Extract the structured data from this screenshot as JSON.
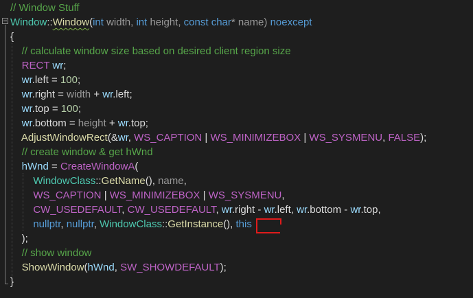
{
  "colors": {
    "background": "#1e1e1e",
    "comment": "#57a64a",
    "keyword": "#569cd6",
    "type": "#4ec9b0",
    "function": "#dcdcaa",
    "macro": "#bd63c5",
    "identifier": "#9cdcfe",
    "param": "#9a9a9a",
    "number": "#b5cea8",
    "default": "#dcdcdc",
    "annotation": "#e01b1b"
  },
  "code_lines": [
    [
      {
        "t": "// Window Stuff",
        "c": "comment"
      }
    ],
    [
      {
        "t": "Window",
        "c": "type"
      },
      {
        "t": "::",
        "c": "default"
      },
      {
        "t": "Window",
        "c": "function",
        "sq": true
      },
      {
        "t": "(",
        "c": "default"
      },
      {
        "t": "int",
        "c": "keyword"
      },
      {
        "t": " width, ",
        "c": "param"
      },
      {
        "t": "int",
        "c": "keyword"
      },
      {
        "t": " height, ",
        "c": "param"
      },
      {
        "t": "const",
        "c": "keyword"
      },
      {
        "t": " ",
        "c": "default"
      },
      {
        "t": "char",
        "c": "keyword"
      },
      {
        "t": "* name) ",
        "c": "param"
      },
      {
        "t": "noexcept",
        "c": "keyword"
      }
    ],
    [
      {
        "t": "{",
        "c": "default"
      }
    ],
    [
      {
        "t": "    // calculate window size based on desired client region size",
        "c": "comment"
      }
    ],
    [
      {
        "t": "    RECT",
        "c": "macro"
      },
      {
        "t": " ",
        "c": "default"
      },
      {
        "t": "wr",
        "c": "identifier"
      },
      {
        "t": ";",
        "c": "default"
      }
    ],
    [
      {
        "t": "    wr",
        "c": "identifier"
      },
      {
        "t": ".left = ",
        "c": "default"
      },
      {
        "t": "100",
        "c": "number"
      },
      {
        "t": ";",
        "c": "default"
      }
    ],
    [
      {
        "t": "    wr",
        "c": "identifier"
      },
      {
        "t": ".right = ",
        "c": "default"
      },
      {
        "t": "width",
        "c": "param"
      },
      {
        "t": " + ",
        "c": "default"
      },
      {
        "t": "wr",
        "c": "identifier"
      },
      {
        "t": ".left;",
        "c": "default"
      }
    ],
    [
      {
        "t": "    wr",
        "c": "identifier"
      },
      {
        "t": ".top = ",
        "c": "default"
      },
      {
        "t": "100",
        "c": "number"
      },
      {
        "t": ";",
        "c": "default"
      }
    ],
    [
      {
        "t": "    wr",
        "c": "identifier"
      },
      {
        "t": ".bottom = ",
        "c": "default"
      },
      {
        "t": "height",
        "c": "param"
      },
      {
        "t": " + ",
        "c": "default"
      },
      {
        "t": "wr",
        "c": "identifier"
      },
      {
        "t": ".top;",
        "c": "default"
      }
    ],
    [
      {
        "t": "    AdjustWindowRect",
        "c": "function"
      },
      {
        "t": "(&",
        "c": "default"
      },
      {
        "t": "wr",
        "c": "identifier"
      },
      {
        "t": ", ",
        "c": "default"
      },
      {
        "t": "WS_CAPTION",
        "c": "macro"
      },
      {
        "t": " | ",
        "c": "default"
      },
      {
        "t": "WS_MINIMIZEBOX",
        "c": "macro"
      },
      {
        "t": " | ",
        "c": "default"
      },
      {
        "t": "WS_SYSMENU",
        "c": "macro"
      },
      {
        "t": ", ",
        "c": "default"
      },
      {
        "t": "FALSE",
        "c": "macro"
      },
      {
        "t": ");",
        "c": "default"
      }
    ],
    [
      {
        "t": "    // create window & get hWnd",
        "c": "comment"
      }
    ],
    [
      {
        "t": "    hWnd",
        "c": "identifier"
      },
      {
        "t": " = ",
        "c": "default"
      },
      {
        "t": "CreateWindowA",
        "c": "macro"
      },
      {
        "t": "(",
        "c": "default"
      }
    ],
    [
      {
        "t": "        WindowClass",
        "c": "type"
      },
      {
        "t": "::",
        "c": "default"
      },
      {
        "t": "GetName",
        "c": "function"
      },
      {
        "t": "(), ",
        "c": "default"
      },
      {
        "t": "name",
        "c": "param"
      },
      {
        "t": ",",
        "c": "default"
      }
    ],
    [
      {
        "t": "        WS_CAPTION",
        "c": "macro"
      },
      {
        "t": " | ",
        "c": "default"
      },
      {
        "t": "WS_MINIMIZEBOX",
        "c": "macro"
      },
      {
        "t": " | ",
        "c": "default"
      },
      {
        "t": "WS_SYSMENU",
        "c": "macro"
      },
      {
        "t": ",",
        "c": "default"
      }
    ],
    [
      {
        "t": "        CW_USEDEFAULT",
        "c": "macro"
      },
      {
        "t": ", ",
        "c": "default"
      },
      {
        "t": "CW_USEDEFAULT",
        "c": "macro"
      },
      {
        "t": ", ",
        "c": "default"
      },
      {
        "t": "wr",
        "c": "identifier"
      },
      {
        "t": ".right - ",
        "c": "default"
      },
      {
        "t": "wr",
        "c": "identifier"
      },
      {
        "t": ".left, ",
        "c": "default"
      },
      {
        "t": "wr",
        "c": "identifier"
      },
      {
        "t": ".bottom - ",
        "c": "default"
      },
      {
        "t": "wr",
        "c": "identifier"
      },
      {
        "t": ".top,",
        "c": "default"
      }
    ],
    [
      {
        "t": "        nullptr",
        "c": "keyword"
      },
      {
        "t": ", ",
        "c": "default"
      },
      {
        "t": "nullptr",
        "c": "keyword"
      },
      {
        "t": ", ",
        "c": "default"
      },
      {
        "t": "WindowClass",
        "c": "type"
      },
      {
        "t": "::",
        "c": "default"
      },
      {
        "t": "GetInstance",
        "c": "function"
      },
      {
        "t": "(), ",
        "c": "default"
      },
      {
        "t": "this",
        "c": "keyword"
      }
    ],
    [
      {
        "t": "    );",
        "c": "default"
      }
    ],
    [
      {
        "t": "    // show window",
        "c": "comment"
      }
    ],
    [
      {
        "t": "    ShowWindow",
        "c": "function"
      },
      {
        "t": "(",
        "c": "default"
      },
      {
        "t": "hWnd",
        "c": "identifier"
      },
      {
        "t": ", ",
        "c": "default"
      },
      {
        "t": "SW_SHOWDEFAULT",
        "c": "macro"
      },
      {
        "t": ");",
        "c": "default"
      }
    ],
    [
      {
        "t": "}",
        "c": "default"
      }
    ]
  ]
}
